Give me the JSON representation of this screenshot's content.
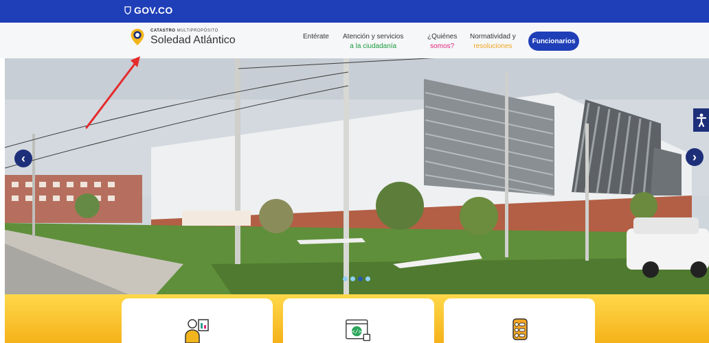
{
  "gov_bar": {
    "logo_text": "GOV.CO"
  },
  "brand": {
    "small_bold": "CATASTRO",
    "small_light": "MULTIPROPÓSITO",
    "name": "Soledad Atlántico"
  },
  "nav": [
    {
      "line1": "Entérate",
      "line2": ""
    },
    {
      "line1": "Atención y servicios",
      "line2": "a la ciudadanía"
    },
    {
      "line1": "¿Quiénes",
      "line2": "somos?"
    },
    {
      "line1": "Normatividad y",
      "line2": "resoluciones"
    }
  ],
  "nav_colors": {
    "ciudadania": "#1a9a3c",
    "somos": "#e0237a",
    "resoluciones": "#f0a41b"
  },
  "funcionarios_label": "Funcionarios",
  "carousel": {
    "prev": "‹",
    "next": "›",
    "slide_count": 4,
    "active_slide": 3
  },
  "accessibility": {
    "icon": "accessibility-icon"
  },
  "cards": [
    {
      "icon": "person-document-icon"
    },
    {
      "icon": "code-screen-lock-icon"
    },
    {
      "icon": "list-document-icon"
    }
  ],
  "colors": {
    "gov_blue": "#1f3fb8",
    "accent_yellow": "#ffd84a",
    "dark_navy": "#1e2f7a"
  }
}
